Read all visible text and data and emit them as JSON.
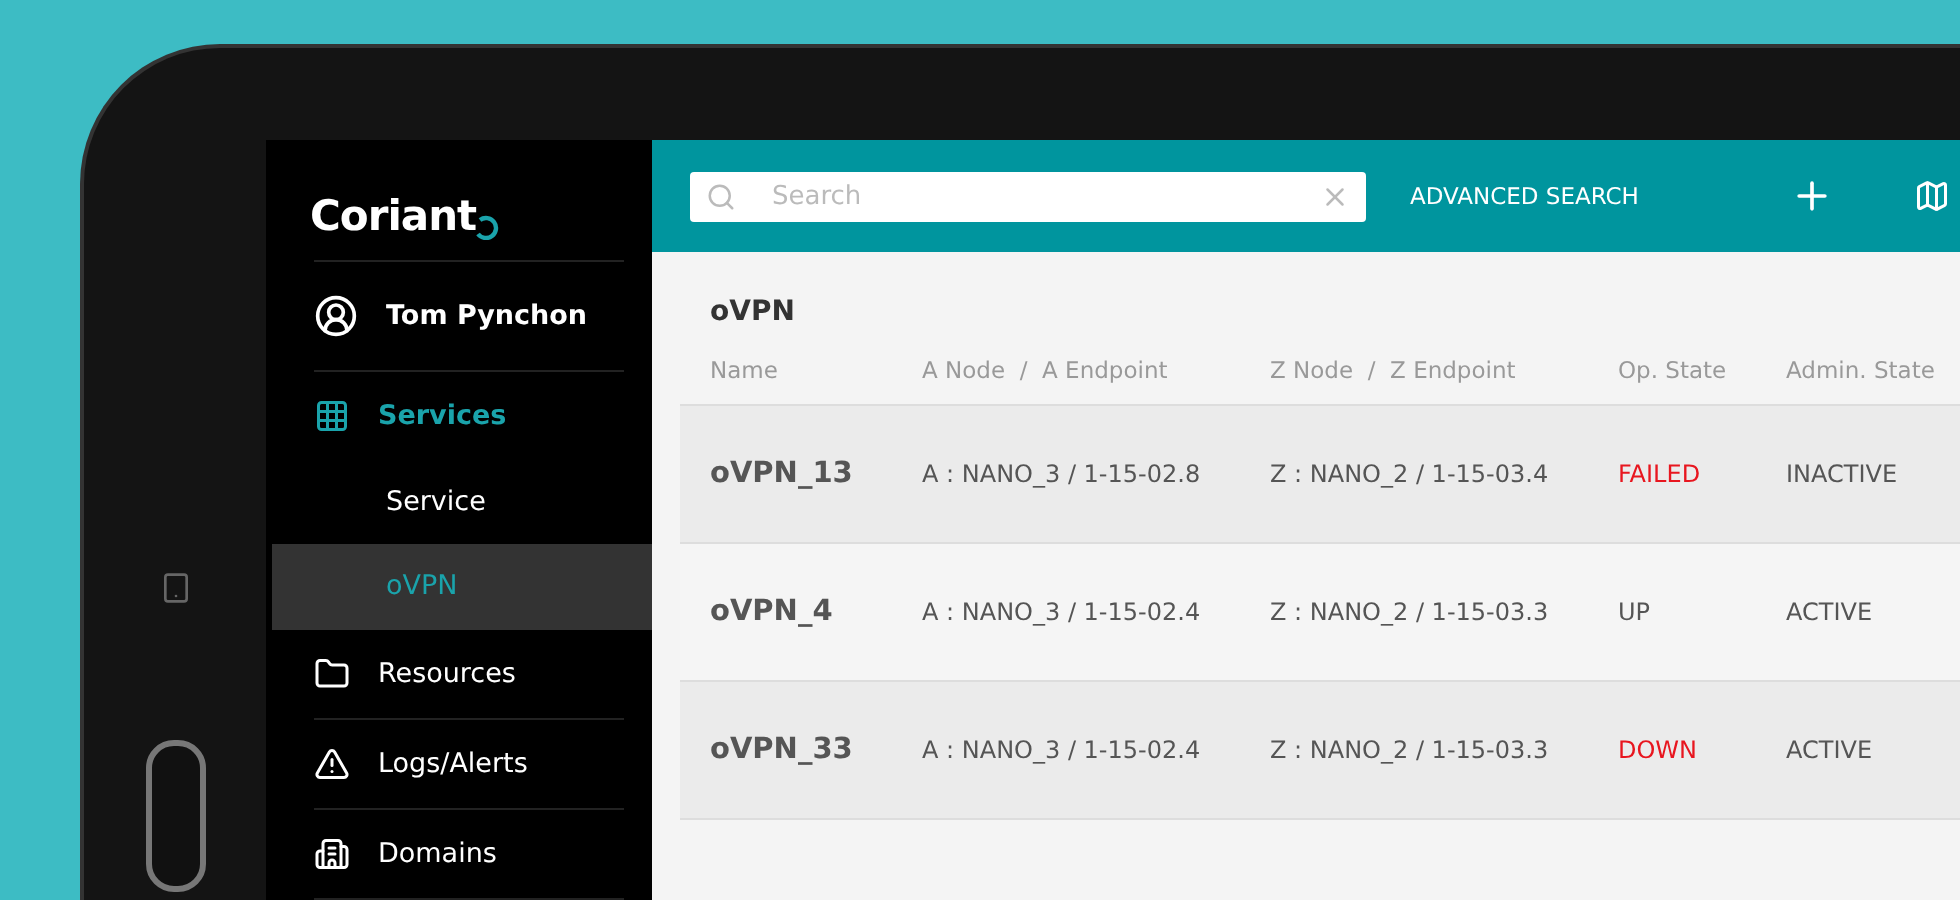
{
  "sidebar": {
    "logo": "Coriant",
    "user": {
      "name": "Tom Pynchon"
    },
    "items": [
      {
        "label": "Services",
        "expanded": true,
        "children": [
          {
            "label": "Service",
            "selected": false
          },
          {
            "label": "oVPN",
            "selected": true
          }
        ]
      },
      {
        "label": "Resources",
        "expanded": false
      },
      {
        "label": "Logs/Alerts",
        "expanded": false
      },
      {
        "label": "Domains",
        "expanded": false
      }
    ]
  },
  "toolbar": {
    "search": {
      "placeholder": "Search"
    },
    "advanced_search": "ADVANCED SEARCH"
  },
  "page_title": "oVPN",
  "table": {
    "columns": [
      "Name",
      "A Node  /  A Endpoint",
      "Z Node  /  Z Endpoint",
      "Op. State",
      "Admin. State"
    ],
    "rows": [
      {
        "name": "oVPN_13",
        "a": "A : NANO_3 / 1-15-02.8",
        "z": "Z : NANO_2 / 1-15-03.4",
        "op_state": "FAILED",
        "op_alert": true,
        "admin_state": "INACTIVE"
      },
      {
        "name": "oVPN_4",
        "a": "A : NANO_3 / 1-15-02.4",
        "z": "Z : NANO_2 / 1-15-03.3",
        "op_state": "UP",
        "op_alert": false,
        "admin_state": "ACTIVE"
      },
      {
        "name": "oVPN_33",
        "a": "A : NANO_3 / 1-15-02.4",
        "z": "Z : NANO_2 / 1-15-03.3",
        "op_state": "DOWN",
        "op_alert": true,
        "admin_state": "ACTIVE"
      }
    ]
  }
}
